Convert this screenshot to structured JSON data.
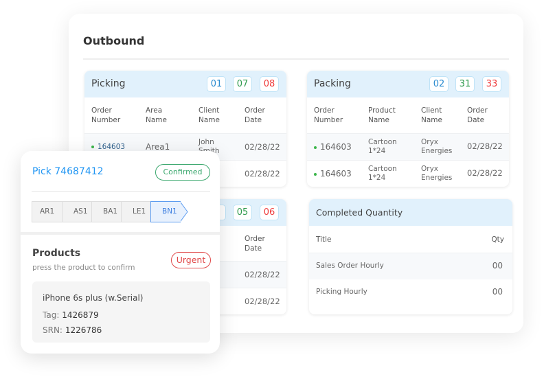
{
  "outbound": {
    "title": "Outbound",
    "picking": {
      "title": "Picking",
      "badges": [
        "01",
        "07",
        "08"
      ],
      "columns": [
        "Order\nNumber",
        "Area\nName",
        "Client\nName",
        "Order\nDate"
      ],
      "rows": [
        {
          "order": "164603",
          "area": "Area1",
          "client": "John\nSmith",
          "date": "02/28/22"
        },
        {
          "date": "02/28/22"
        }
      ]
    },
    "packing": {
      "title": "Packing",
      "badges": [
        "02",
        "31",
        "33"
      ],
      "columns": [
        "Order\nNumber",
        "Product\nName",
        "Client\nName",
        "Order\nDate"
      ],
      "rows": [
        {
          "order": "164603",
          "product": "Cartoon\n1*24",
          "client": "Oryx\nEnergies",
          "date": "02/28/22"
        },
        {
          "order": "164603",
          "product": "Cartoon\n1*24",
          "client": "Oryx\nEnergies",
          "date": "02/28/22"
        }
      ]
    },
    "third": {
      "badges": [
        "05",
        "06"
      ],
      "columns": [
        "Order\nDate"
      ],
      "rows": [
        {
          "date": "02/28/22"
        },
        {
          "date": "02/28/22"
        }
      ]
    },
    "completed": {
      "title": "Completed Quantity",
      "columns": [
        "Title",
        "Qty"
      ],
      "rows": [
        {
          "title": "Sales Order Hourly",
          "qty": "00"
        },
        {
          "title": "Picking Hourly",
          "qty": "00"
        }
      ]
    }
  },
  "pick_card": {
    "title": "Pick 74687412",
    "status": "Confirmed",
    "steps": [
      "AR1",
      "AS1",
      "BA1",
      "LE1",
      "BN1"
    ],
    "active_step": "BN1",
    "products_title": "Products",
    "products_hint": "press the product to confirm",
    "priority": "Urgent",
    "product": {
      "name": "iPhone 6s plus (w.Serial)",
      "tag_label": "Tag:",
      "tag": "1426879",
      "srn_label": "SRN:",
      "srn": "1226786"
    }
  },
  "colors": {
    "accent": "#2196f3",
    "header_bg": "#e1f1fc",
    "green": "#2e9a4c",
    "red": "#ef3b3b"
  }
}
